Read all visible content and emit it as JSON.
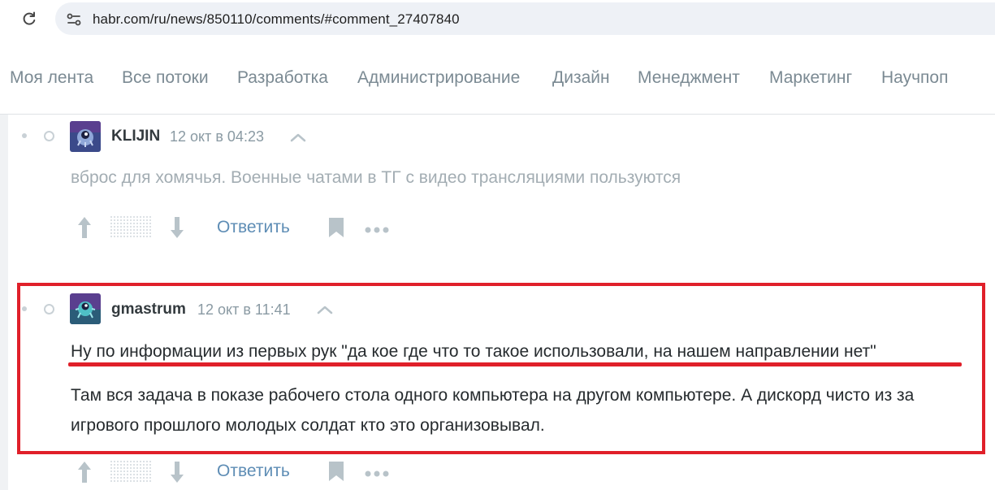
{
  "browser": {
    "url": "habr.com/ru/news/850110/comments/#comment_27407840",
    "icons": [
      "reload-icon",
      "site-info-icon"
    ]
  },
  "nav": {
    "items": [
      "Моя лента",
      "Все потоки",
      "Разработка",
      "Администрирование",
      "Дизайн",
      "Менеджмент",
      "Маркетинг",
      "Научпоп"
    ]
  },
  "comments": [
    {
      "username": "KLIJIN",
      "timestamp": "12 окт в 04:23",
      "text": "вброс для хомячья. Военные чатами в ТГ с видео трансляциями пользуются",
      "reply_label": "Ответить"
    },
    {
      "username": "gmastrum",
      "timestamp": "12 окт в 11:41",
      "line1": "Ну по информации из первых рук \"да кое где что то такое использовали, на нашем направлении нет\"",
      "line2": "Там вся задача в показе рабочего стола одного компьютера на другом компьютере. А дискорд чисто из за игрового прошлого молодых солдат кто это организовывал.",
      "reply_label": "Ответить"
    }
  ],
  "colors": {
    "highlight": "#e0202a",
    "reply_link": "#5e8db5",
    "nav_text": "#7b8a93"
  }
}
